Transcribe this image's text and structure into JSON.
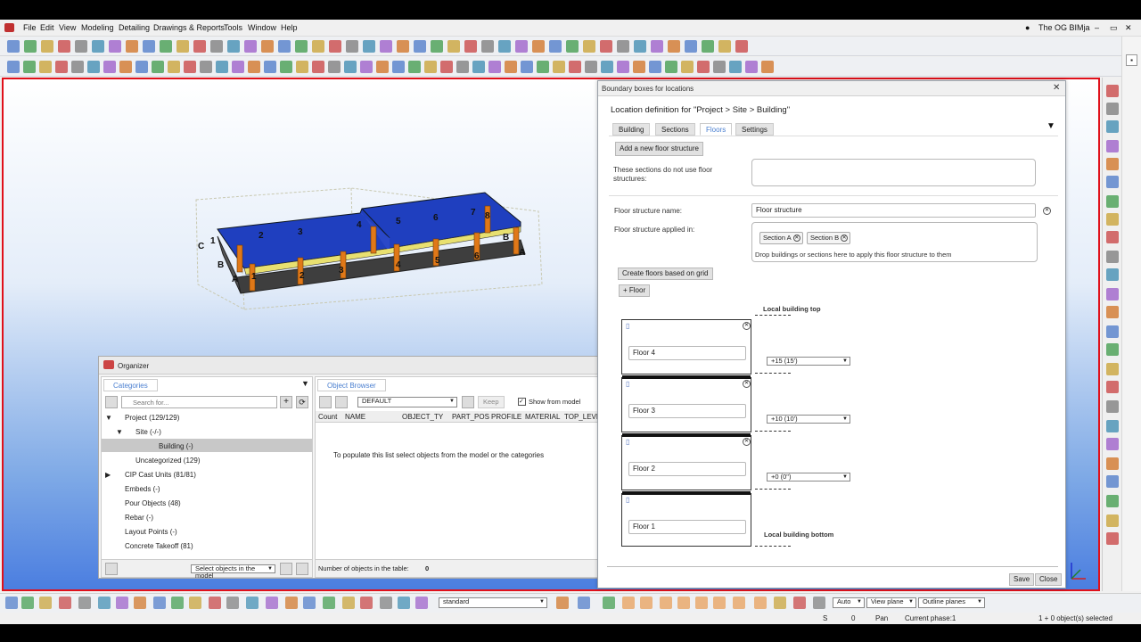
{
  "window": {
    "title": "The OG BIMja",
    "controls": [
      "–",
      "▭",
      "✕"
    ]
  },
  "menu": [
    "File",
    "Edit",
    "View",
    "Modeling",
    "Detailing",
    "Drawings & Reports",
    "Tools",
    "Window",
    "Help"
  ],
  "model_labels": {
    "top": [
      "1",
      "2",
      "3",
      "4",
      "5",
      "6",
      "7",
      "8"
    ],
    "bottom": [
      "1",
      "2",
      "3",
      "4",
      "5",
      "6"
    ],
    "sides": [
      "A",
      "B",
      "C",
      "A",
      "B"
    ]
  },
  "dialog": {
    "title": "Boundary boxes for locations",
    "close": "✕",
    "heading": "Location definition for \"Project > Site > Building\"",
    "tabs": [
      "Building",
      "Sections",
      "Floors",
      "Settings"
    ],
    "active_tab": "Floors",
    "add_floor_structure": "Add a new floor structure",
    "no_floor_structures_label": "These sections do not use floor structures:",
    "floor_structure_name_label": "Floor structure name:",
    "floor_structure_name_value": "Floor structure",
    "applied_in_label": "Floor structure applied in:",
    "applied_chips": [
      "Section A",
      "Section B"
    ],
    "drop_hint": "Drop buildings or sections here to apply this floor structure to them",
    "create_floors_grid": "Create floors based on grid",
    "add_floor": "+ Floor",
    "local_top": "Local building top",
    "local_bottom": "Local building bottom",
    "floors": [
      "Floor 4",
      "Floor 3",
      "Floor 2",
      "Floor 1"
    ],
    "levels": [
      "+15 (15')",
      "+10 (10')",
      "+0 (0\")"
    ],
    "save": "Save",
    "close_btn": "Close"
  },
  "organizer": {
    "title": "Organizer",
    "categories_tab": "Categories",
    "search_placeholder": "Search for...",
    "tree": [
      {
        "label": "Project (129/129)"
      },
      {
        "label": "Site (-/-)"
      },
      {
        "label": "Building (-)"
      },
      {
        "label": "Uncategorized (129)"
      },
      {
        "label": "CIP Cast Units (81/81)"
      },
      {
        "label": "Embeds (-)"
      },
      {
        "label": "Pour Objects (48)"
      },
      {
        "label": "Rebar (-)"
      },
      {
        "label": "Layout Points (-)"
      },
      {
        "label": "Concrete Takeoff (81)"
      }
    ],
    "select_mode": "Select objects in the model",
    "object_browser_tab": "Object Browser",
    "browser_set": "DEFAULT",
    "keep": "Keep",
    "show_from_model": "Show from model",
    "columns": [
      "Count",
      "NAME",
      "OBJECT_TY",
      "PART_POS",
      "PROFILE",
      "MATERIAL",
      "TOP_LEVEL"
    ],
    "empty_message": "To populate this list select objects from the model or the categories",
    "count_label": "Number of objects in the table:",
    "count_value": "0"
  },
  "bottom_toolbar": {
    "selection_filter": "standard",
    "snap_mode": "Auto",
    "plane": "View plane",
    "outline": "Outline planes"
  },
  "status": {
    "s": "S",
    "zero": "0",
    "pan": "Pan",
    "phase": "Current phase:1",
    "selected": "1 + 0 object(s) selected"
  }
}
